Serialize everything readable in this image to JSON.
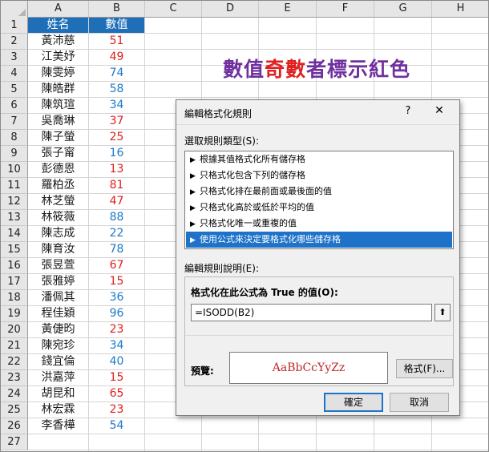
{
  "columns": [
    "A",
    "B",
    "C",
    "D",
    "E",
    "F",
    "G",
    "H"
  ],
  "rows": [
    "1",
    "2",
    "3",
    "4",
    "5",
    "6",
    "7",
    "8",
    "9",
    "10",
    "11",
    "12",
    "13",
    "14",
    "15",
    "16",
    "17",
    "18",
    "19",
    "20",
    "21",
    "22",
    "23",
    "24",
    "25",
    "26",
    "27"
  ],
  "table": {
    "header": [
      "姓名",
      "數值"
    ],
    "data": [
      [
        "黃沛慈",
        "51",
        "odd"
      ],
      [
        "江美妤",
        "49",
        "odd"
      ],
      [
        "陳雯婷",
        "74",
        "even"
      ],
      [
        "陳皓群",
        "58",
        "even"
      ],
      [
        "陳筑瑄",
        "34",
        "even"
      ],
      [
        "吳喬琳",
        "37",
        "odd"
      ],
      [
        "陳子螢",
        "25",
        "odd"
      ],
      [
        "張子甯",
        "16",
        "even"
      ],
      [
        "彭德恩",
        "13",
        "odd"
      ],
      [
        "羅柏丞",
        "81",
        "odd"
      ],
      [
        "林芝螢",
        "47",
        "odd"
      ],
      [
        "林筱薇",
        "88",
        "even"
      ],
      [
        "陳志成",
        "22",
        "even"
      ],
      [
        "陳育汝",
        "78",
        "even"
      ],
      [
        "張昱萱",
        "67",
        "odd"
      ],
      [
        "張雅婷",
        "15",
        "odd"
      ],
      [
        "潘佩其",
        "36",
        "even"
      ],
      [
        "程佳穎",
        "96",
        "even"
      ],
      [
        "黃倢昀",
        "23",
        "odd"
      ],
      [
        "陳宛珍",
        "34",
        "even"
      ],
      [
        "錢宜倫",
        "40",
        "even"
      ],
      [
        "洪嘉萍",
        "15",
        "odd"
      ],
      [
        "胡昆和",
        "65",
        "odd"
      ],
      [
        "林宏霖",
        "23",
        "odd"
      ],
      [
        "李香樺",
        "54",
        "even"
      ]
    ]
  },
  "banner": {
    "parts": [
      {
        "text": "數值",
        "color": "#7030a0"
      },
      {
        "text": "奇數",
        "color": "#e02020"
      },
      {
        "text": "者標示紅色",
        "color": "#7030a0"
      }
    ]
  },
  "dialog": {
    "title": "編輯格式化規則",
    "help": "?",
    "close": "✕",
    "select_rule_label": "選取規則類型(S):",
    "rule_types": [
      "根據其值格式化所有儲存格",
      "只格式化包含下列的儲存格",
      "只格式化排在最前面或最後面的值",
      "只格式化高於或低於平均的值",
      "只格式化唯一或重複的值",
      "使用公式來決定要格式化哪些儲存格"
    ],
    "selected_rule_index": 5,
    "edit_desc_label": "編輯規則說明(E):",
    "formula_label": "格式化在此公式為 True 的值(O):",
    "formula_value": "=ISODD(B2)",
    "preview_label": "預覽:",
    "preview_text": "AaBbCcYyZz",
    "format_button": "格式(F)...",
    "ok_button": "確定",
    "cancel_button": "取消"
  }
}
